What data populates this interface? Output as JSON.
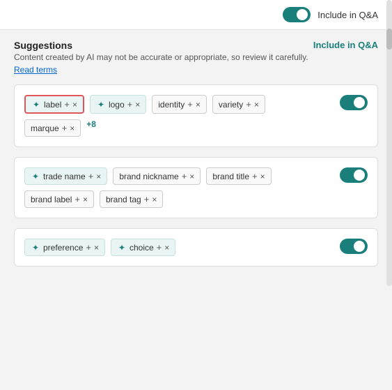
{
  "topbar": {
    "toggle_label": "Include in Q&A",
    "toggle_on": true
  },
  "suggestions": {
    "title": "Suggestions",
    "subtitle": "Content created by AI may not be accurate or appropriate, so review it carefully.",
    "read_terms_link": "Read terms",
    "column_header": "Include in Q&A"
  },
  "cards": [
    {
      "id": "card-1",
      "toggle_on": true,
      "highlighted_tag": "label",
      "tags_ai": [
        "label",
        "logo"
      ],
      "tags_plain": [
        "identity",
        "variety"
      ],
      "tags_plain2": [
        "marque"
      ],
      "more": "+8"
    },
    {
      "id": "card-2",
      "toggle_on": true,
      "tags_ai": [
        "trade name"
      ],
      "tags_plain": [
        "brand nickname",
        "brand title"
      ],
      "tags_plain2": [
        "brand label",
        "brand tag"
      ]
    },
    {
      "id": "card-3",
      "toggle_on": true,
      "tags_ai": [
        "preference",
        "choice"
      ],
      "tags_plain": []
    }
  ],
  "icons": {
    "ai": "✦",
    "plus": "+",
    "close": "×"
  }
}
